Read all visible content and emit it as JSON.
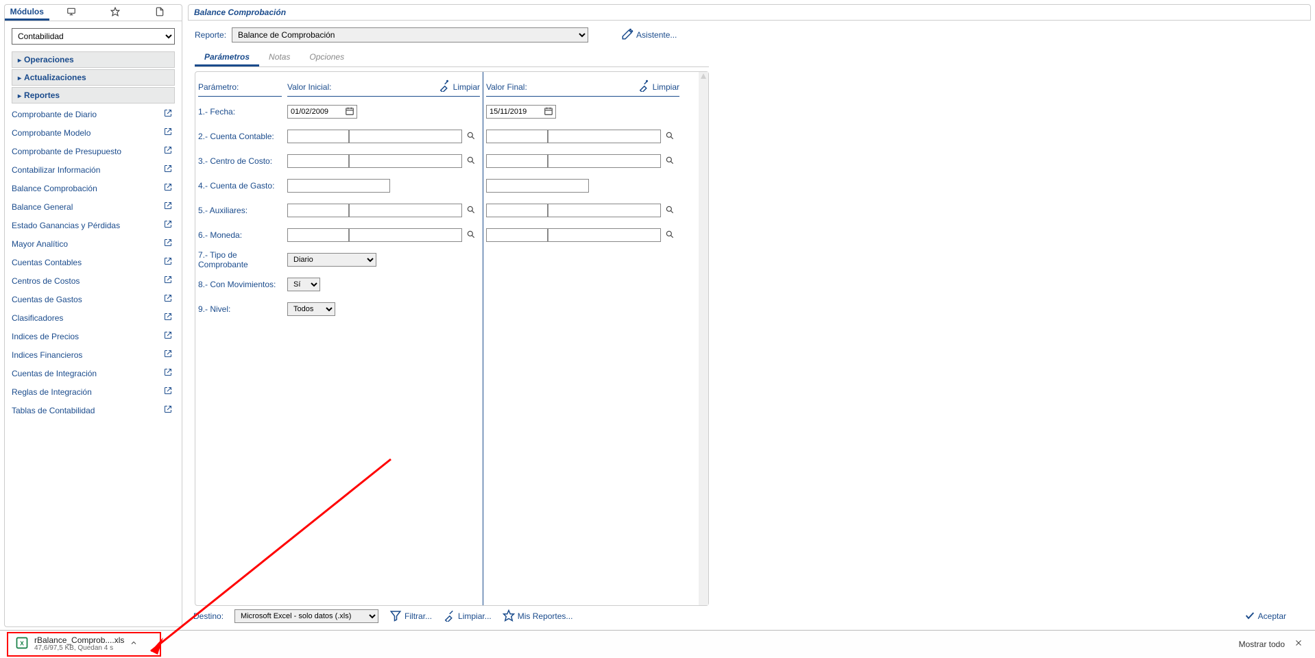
{
  "sidebar": {
    "tabs": {
      "modulos": "Módulos"
    },
    "module_selected": "Contabilidad",
    "sections": [
      "Operaciones",
      "Actualizaciones",
      "Reportes"
    ],
    "reports": [
      "Comprobante de Diario",
      "Comprobante Modelo",
      "Comprobante de Presupuesto",
      "Contabilizar Información",
      "Balance Comprobación",
      "Balance General",
      "Estado Ganancias y Pérdidas",
      "Mayor Analítico",
      "Cuentas Contables",
      "Centros de Costos",
      "Cuentas de Gastos",
      "Clasificadores",
      "Indices de Precios",
      "Indices Financieros",
      "Cuentas de Integración",
      "Reglas de Integración",
      "Tablas de Contabilidad"
    ]
  },
  "main": {
    "title": "Balance Comprobación",
    "reporte_label": "Reporte:",
    "reporte_value": "Balance de Comprobación",
    "asistente": "Asistente...",
    "tabs": [
      "Parámetros",
      "Notas",
      "Opciones"
    ],
    "colhead_param": "Parámetro:",
    "colhead_init": "Valor Inicial:",
    "colhead_final": "Valor Final:",
    "limpiar": "Limpiar",
    "params": [
      "1.- Fecha:",
      "2.- Cuenta Contable:",
      "3.- Centro de Costo:",
      "4.- Cuenta de Gasto:",
      "5.- Auxiliares:",
      "6.- Moneda:",
      "7.- Tipo de Comprobante",
      "8.- Con Movimientos:",
      "9.- Nivel:"
    ],
    "fecha_init": "01/02/2009",
    "fecha_final": "15/11/2019",
    "tipo_comprobante": "Diario",
    "con_movimientos": "Sí",
    "nivel": "Todos"
  },
  "footer": {
    "destino_label": "Destino:",
    "destino_value": "Microsoft Excel - solo datos (.xls)",
    "filtrar": "Filtrar...",
    "limpiar": "Limpiar...",
    "mis_reportes": "Mis Reportes...",
    "aceptar": "Aceptar"
  },
  "download": {
    "filename": "rBalance_Comprob....xls",
    "status": "47,6/97,5 KB, Quedan 4 s",
    "show_all": "Mostrar todo"
  }
}
